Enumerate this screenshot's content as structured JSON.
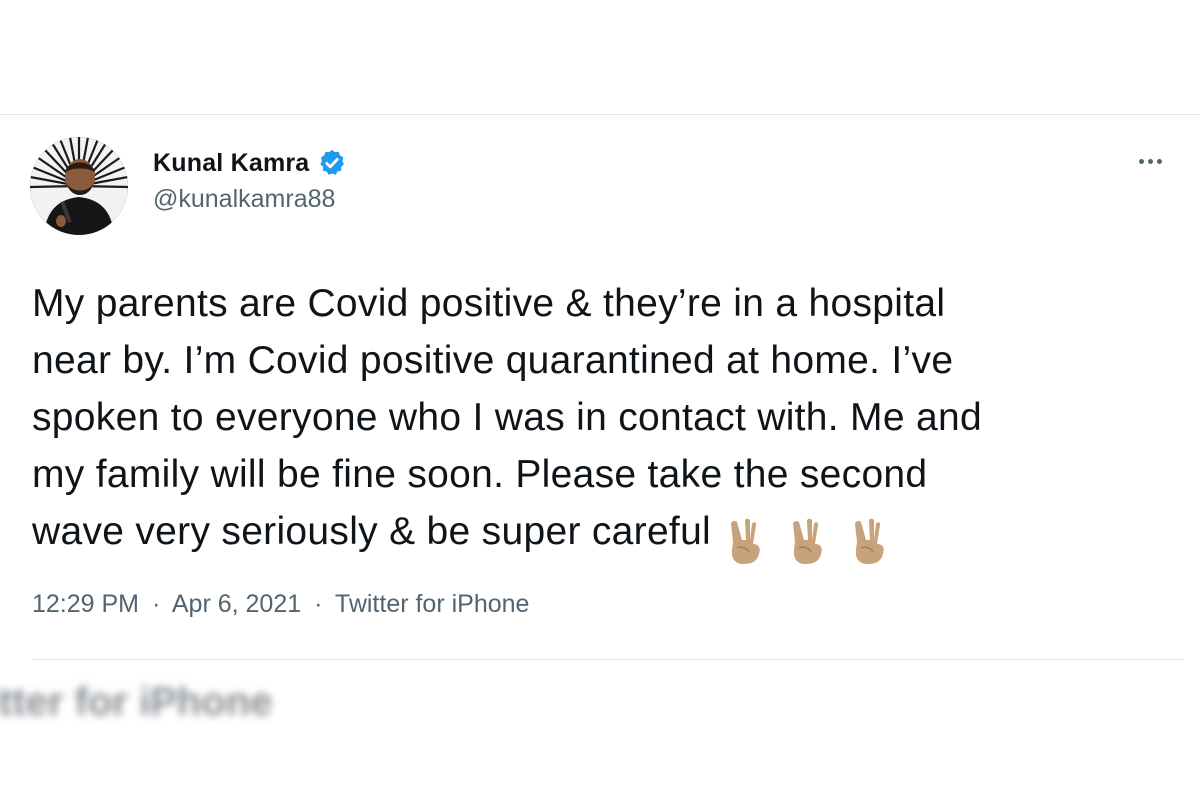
{
  "tweet": {
    "display_name": "Kunal Kamra",
    "handle": "@kunalkamra88",
    "verified": true,
    "text_lines": [
      "My parents are Covid positive & they’re in a hospital",
      "near by. I’m Covid positive quarantined at home. I’ve",
      "spoken to everyone who I was in contact with. Me and",
      "my family will be fine soon. Please take the second",
      "wave very seriously & be super careful"
    ],
    "emojis": [
      "victory-hand-medium-skin-tone",
      "victory-hand-medium-skin-tone",
      "victory-hand-medium-skin-tone"
    ],
    "time": "12:29 PM",
    "date": "Apr 6, 2021",
    "source": "Twitter for iPhone",
    "separator": "·"
  },
  "blurred_footer_text": "itter for iPhone",
  "icons": {
    "verified": "verified-badge-icon",
    "more": "more-options-icon"
  },
  "colors": {
    "text": "#0f1419",
    "secondary": "#536471",
    "verified_blue": "#1d9bf0",
    "divider": "#e1e8ed",
    "emoji_skin": "#c8a27a"
  }
}
